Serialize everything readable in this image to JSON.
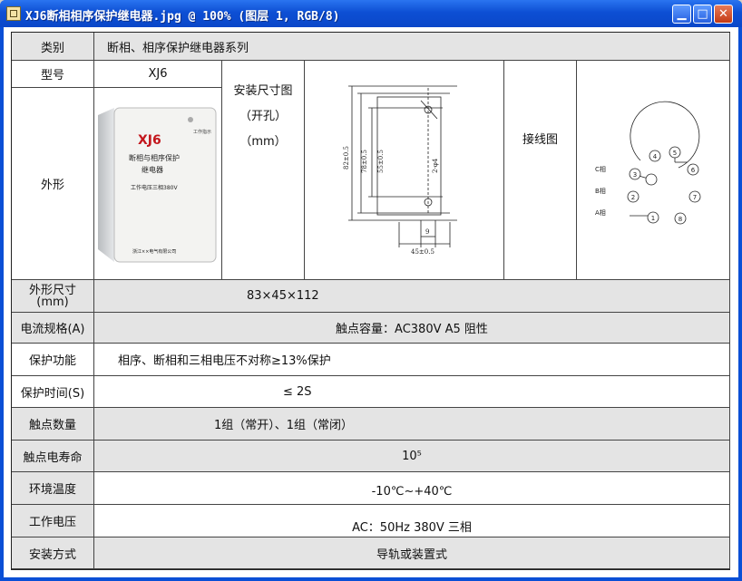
{
  "window": {
    "title": "XJ6断相相序保护继电器.jpg @ 100% (图层 1, RGB/8)",
    "minimize_glyph": "▁",
    "maximize_glyph": "□",
    "close_glyph": "✕"
  },
  "table": {
    "category_label": "类别",
    "category_value": "断相、相序保护继电器系列",
    "model_label": "型号",
    "model_value": "XJ6",
    "appearance_label": "外形",
    "install_label": "安装尺寸图",
    "install_hole": "（开孔）",
    "install_unit": "（mm）",
    "wiring_label": "接线图",
    "size_label_line1": "外形尺寸",
    "size_label_line2": "(mm)",
    "size_value": "83×45×112",
    "current_label": "电流规格(A)",
    "current_value": "触点容量：AC380V A5 阻性",
    "protect_label": "保护功能",
    "protect_value": "相序、断相和三相电压不对称≥13%保护",
    "time_label": "保护时间(S)",
    "time_value": "≤ 2S",
    "contacts_label": "触点数量",
    "contacts_value": "1组（常开）、1组（常闭）",
    "life_label": "触点电寿命",
    "life_value": "10⁵",
    "env_label": "环境温度",
    "env_value": "-10℃~+40℃",
    "voltage_label": "工作电压",
    "voltage_value": "AC：50Hz 380V 三相",
    "mount_label": "安装方式",
    "mount_value": "导轨或装置式"
  },
  "device": {
    "model_text": "XJ6",
    "name_line1": "断相与相序保护",
    "name_line2": "继电器",
    "voltage_text": "工作电压三相380V",
    "lamp_label": "工作指示",
    "maker_text": "浙江××电气有限公司"
  },
  "drawing": {
    "dim_82": "82±0.5",
    "dim_78": "78±0.5",
    "dim_55": "55±0.5",
    "dim_2phi4": "2-φ4",
    "dim_9": "9",
    "dim_45": "45±0.5"
  },
  "wiring": {
    "phase_c": "C相",
    "phase_b": "B相",
    "phase_a": "A相",
    "pins": [
      "1",
      "2",
      "3",
      "4",
      "5",
      "6",
      "7",
      "8"
    ]
  }
}
